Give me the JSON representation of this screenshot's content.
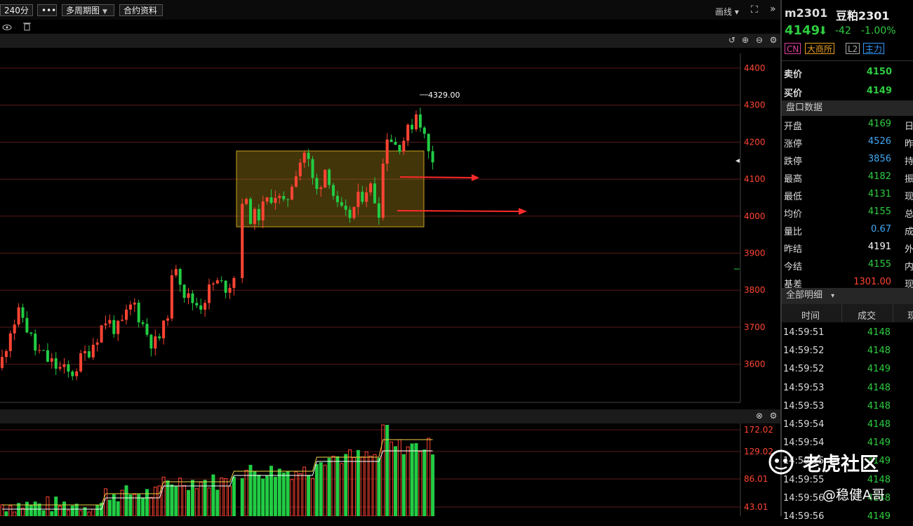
{
  "toolbar": {
    "period": "240分",
    "more": "•••",
    "multi_period": "多周期图",
    "contract_info": "合约资料",
    "draw_line": "画线",
    "draw_caret": "▾",
    "fullscreen_icon": "⛶",
    "collapse_icon": "»"
  },
  "chart": {
    "price_axis": [
      "4400",
      "4300",
      "4200",
      "4100",
      "4000",
      "3900",
      "3800",
      "3700",
      "3600"
    ],
    "high_marker": "4329.00",
    "colors": {
      "up": "#ff4433",
      "down": "#22cc44",
      "grid": "#5a1a1a",
      "box": "#c9a21d",
      "arrow": "#ff2a2a"
    }
  },
  "volume": {
    "axis": [
      "172.02",
      "129.02",
      "86.01",
      "43.01"
    ]
  },
  "panel": {
    "symbol": "m2301",
    "name": "豆粕2301",
    "price": "4149",
    "arrow": "⬇",
    "change": "-42",
    "change_pct": "-1.00%",
    "tags": [
      {
        "label": "CN",
        "color": "#e040a0"
      },
      {
        "label": "大商所",
        "color": "#e8a020"
      },
      {
        "label": "L2",
        "color": "#aaaaaa"
      },
      {
        "label": "主力",
        "color": "#3399ff"
      }
    ],
    "ask_label": "卖价",
    "ask": "4150",
    "bid_label": "买价",
    "bid": "4149",
    "quote_header": "盘口数据",
    "quotes": [
      {
        "label": "开盘",
        "value": "4169",
        "color": "#2ecc40",
        "extra": "日"
      },
      {
        "label": "涨停",
        "value": "4526",
        "color": "#3fa9f5",
        "extra": "昨"
      },
      {
        "label": "跌停",
        "value": "3856",
        "color": "#3fa9f5",
        "extra": "持"
      },
      {
        "label": "最高",
        "value": "4182",
        "color": "#2ecc40",
        "extra": "振"
      },
      {
        "label": "最低",
        "value": "4131",
        "color": "#2ecc40",
        "extra": "现"
      },
      {
        "label": "均价",
        "value": "4155",
        "color": "#2ecc40",
        "extra": "总"
      },
      {
        "label": "量比",
        "value": "0.67",
        "color": "#3fa9f5",
        "extra": "成"
      },
      {
        "label": "昨结",
        "value": "4191",
        "color": "#ffffff",
        "extra": "外"
      },
      {
        "label": "今结",
        "value": "4155",
        "color": "#2ecc40",
        "extra": "内"
      },
      {
        "label": "基差",
        "value": "1301.00",
        "color": "#ff4433",
        "extra": "现"
      }
    ],
    "detail_header": "全部明细",
    "detail_caret": "▾",
    "detail_cols": [
      "时间",
      "成交",
      "现"
    ],
    "details": [
      {
        "time": "14:59:51",
        "price": "4148"
      },
      {
        "time": "14:59:52",
        "price": "4148"
      },
      {
        "time": "14:59:52",
        "price": "4149"
      },
      {
        "time": "14:59:53",
        "price": "4148"
      },
      {
        "time": "14:59:53",
        "price": "4148"
      },
      {
        "time": "14:59:54",
        "price": "4148"
      },
      {
        "time": "14:59:54",
        "price": "4149"
      },
      {
        "time": "14:59:55",
        "price": "4149"
      },
      {
        "time": "14:59:55",
        "price": "4148"
      },
      {
        "time": "14:59:56",
        "price": "4148"
      },
      {
        "time": "14:59:56",
        "price": "4149"
      }
    ]
  },
  "watermark": {
    "main": "老虎社区",
    "sub": "@稳健A哥"
  }
}
